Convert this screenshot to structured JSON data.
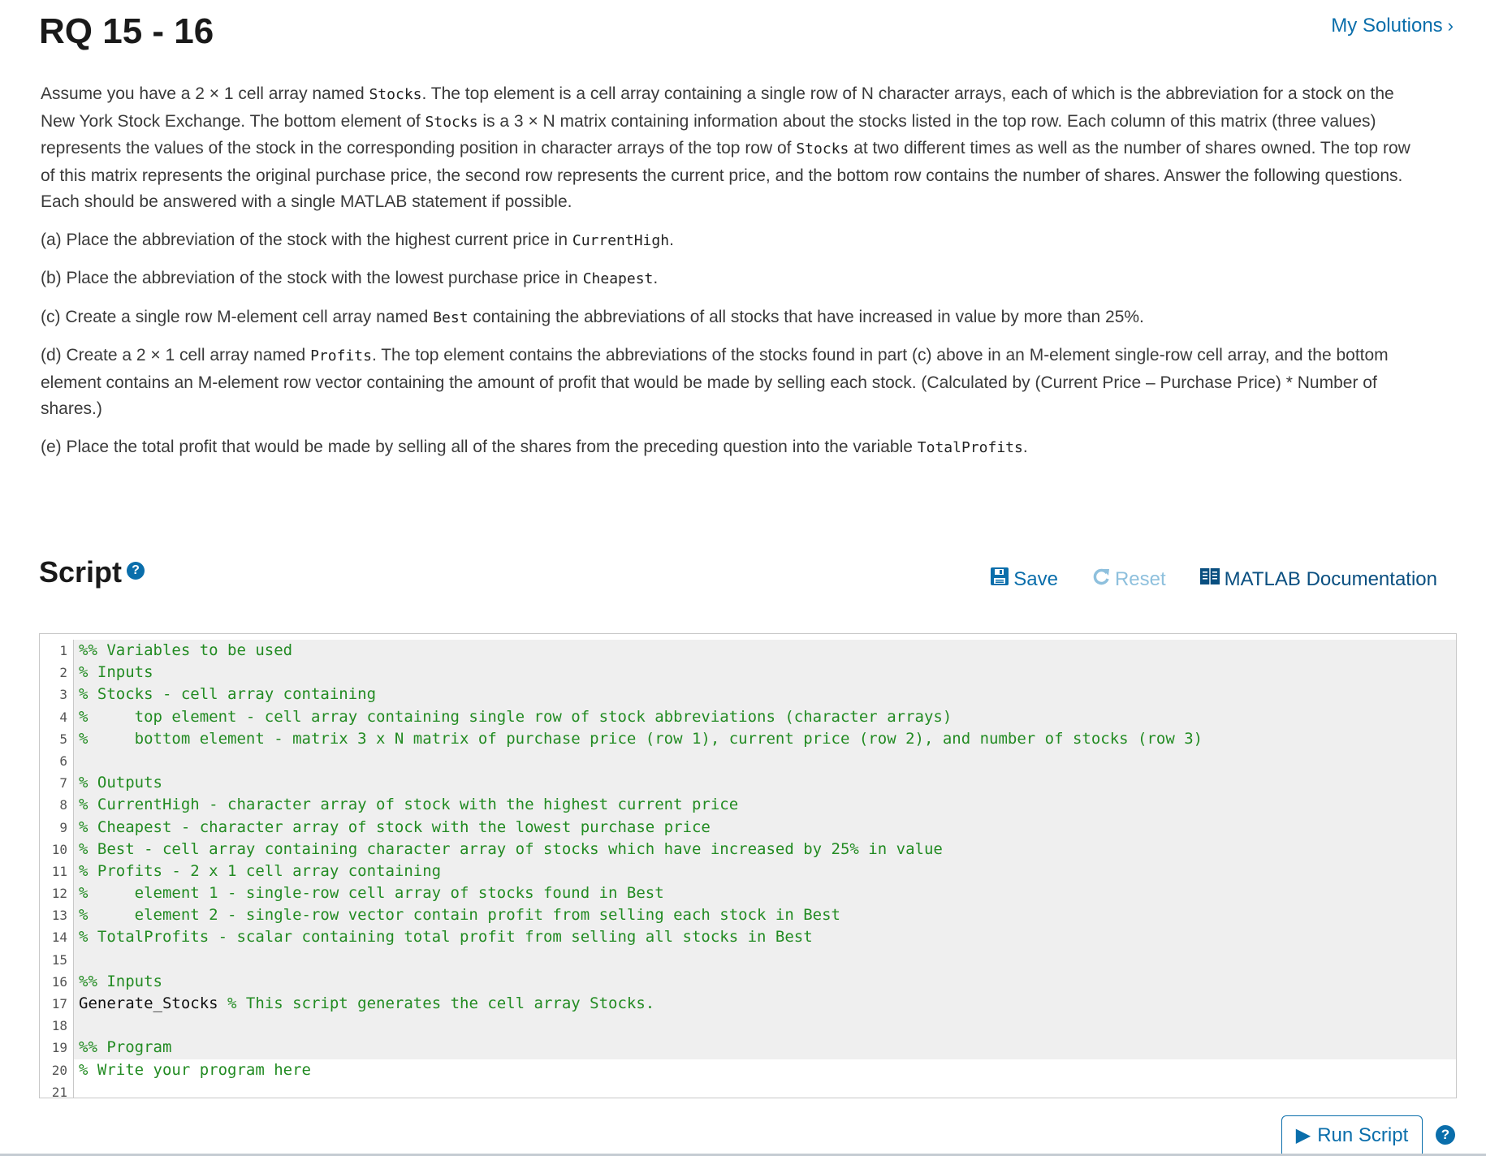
{
  "header": {
    "title": "RQ 15 - 16",
    "my_solutions_label": "My Solutions",
    "my_solutions_icon": "chevron-right-icon"
  },
  "description": {
    "intro": [
      {
        "t": "Assume you have a 2 × 1 cell array named "
      },
      {
        "c": "Stocks"
      },
      {
        "t": ". The top element is a cell array containing a single row of N character arrays, each of which is the abbreviation for a stock on the New York Stock Exchange. The bottom element of "
      },
      {
        "c": "Stocks"
      },
      {
        "t": " is a 3 × N matrix containing information about the stocks listed in the top row. Each column of this matrix (three values) represents the values of the stock in the corresponding position in character arrays of the top row of "
      },
      {
        "c": "Stocks"
      },
      {
        "t": " at two different times as well as the number of shares owned. The top row of this matrix represents the original purchase price, the second row represents the current price, and the bottom row contains the number of shares. Answer the following questions. Each should be answered with a single MATLAB statement if possible."
      }
    ],
    "parts": [
      [
        {
          "t": "(a) Place the abbreviation of the stock with the highest current price in "
        },
        {
          "c": "CurrentHigh"
        },
        {
          "t": "."
        }
      ],
      [
        {
          "t": "(b) Place the abbreviation of the stock with the lowest purchase price in "
        },
        {
          "c": "Cheapest"
        },
        {
          "t": "."
        }
      ],
      [
        {
          "t": "(c) Create a single row M-element cell array named "
        },
        {
          "c": "Best"
        },
        {
          "t": " containing the abbreviations of all stocks that have increased in value by more than 25%."
        }
      ],
      [
        {
          "t": "(d) Create a 2 × 1 cell array named "
        },
        {
          "c": "Profits"
        },
        {
          "t": ". The top element contains the abbreviations of the stocks found in part (c) above in an M-element single-row cell array, and the bottom element contains an M-element row vector containing the amount of profit that would be made by selling each stock. (Calculated by (Current Price – Purchase Price) * Number of shares.)"
        }
      ],
      [
        {
          "t": "(e) Place the total profit that would be made by selling all of the shares from the preceding question into the variable "
        },
        {
          "c": "TotalProfits"
        },
        {
          "t": "."
        }
      ]
    ]
  },
  "script": {
    "heading": "Script",
    "help_icon": "question-circle-icon",
    "toolbar": {
      "save_label": "Save",
      "save_icon": "floppy-disk-icon",
      "reset_label": "Reset",
      "reset_icon": "refresh-icon",
      "docs_label": "MATLAB Documentation",
      "docs_icon": "book-icon"
    },
    "lines": [
      {
        "n": "1",
        "ro": true,
        "segs": [
          {
            "k": "comment",
            "s": "%% Variables to be used"
          }
        ]
      },
      {
        "n": "2",
        "ro": true,
        "segs": [
          {
            "k": "comment",
            "s": "% Inputs"
          }
        ]
      },
      {
        "n": "3",
        "ro": true,
        "segs": [
          {
            "k": "comment",
            "s": "% Stocks - cell array containing"
          }
        ]
      },
      {
        "n": "4",
        "ro": true,
        "segs": [
          {
            "k": "comment",
            "s": "%     top element - cell array containing single row of stock abbreviations (character arrays)"
          }
        ]
      },
      {
        "n": "5",
        "ro": true,
        "segs": [
          {
            "k": "comment",
            "s": "%     bottom element - matrix 3 x N matrix of purchase price (row 1), current price (row 2), and number of stocks (row 3)"
          }
        ]
      },
      {
        "n": "6",
        "ro": true,
        "segs": []
      },
      {
        "n": "7",
        "ro": true,
        "segs": [
          {
            "k": "comment",
            "s": "% Outputs"
          }
        ]
      },
      {
        "n": "8",
        "ro": true,
        "segs": [
          {
            "k": "comment",
            "s": "% CurrentHigh - character array of stock with the highest current price"
          }
        ]
      },
      {
        "n": "9",
        "ro": true,
        "segs": [
          {
            "k": "comment",
            "s": "% Cheapest - character array of stock with the lowest purchase price"
          }
        ]
      },
      {
        "n": "10",
        "ro": true,
        "segs": [
          {
            "k": "comment",
            "s": "% Best - cell array containing character array of stocks which have increased by 25% in value"
          }
        ]
      },
      {
        "n": "11",
        "ro": true,
        "segs": [
          {
            "k": "comment",
            "s": "% Profits - 2 x 1 cell array containing"
          }
        ]
      },
      {
        "n": "12",
        "ro": true,
        "segs": [
          {
            "k": "comment",
            "s": "%     element 1 - single-row cell array of stocks found in Best"
          }
        ]
      },
      {
        "n": "13",
        "ro": true,
        "segs": [
          {
            "k": "comment",
            "s": "%     element 2 - single-row vector contain profit from selling each stock in Best"
          }
        ]
      },
      {
        "n": "14",
        "ro": true,
        "segs": [
          {
            "k": "comment",
            "s": "% TotalProfits - scalar containing total profit from selling all stocks in Best"
          }
        ]
      },
      {
        "n": "15",
        "ro": true,
        "segs": []
      },
      {
        "n": "16",
        "ro": true,
        "segs": [
          {
            "k": "comment",
            "s": "%% Inputs"
          }
        ]
      },
      {
        "n": "17",
        "ro": true,
        "segs": [
          {
            "k": "plain",
            "s": "Generate_Stocks "
          },
          {
            "k": "comment",
            "s": "% This script generates the cell array Stocks."
          }
        ]
      },
      {
        "n": "18",
        "ro": true,
        "segs": []
      },
      {
        "n": "19",
        "ro": true,
        "segs": [
          {
            "k": "comment",
            "s": "%% Program"
          }
        ]
      },
      {
        "n": "20",
        "ro": false,
        "segs": [
          {
            "k": "comment",
            "s": "% Write your program here"
          }
        ]
      },
      {
        "n": "21",
        "ro": false,
        "segs": []
      }
    ],
    "run_label": "Run Script",
    "run_icon": "play-icon",
    "run_help_icon": "question-circle-icon"
  },
  "colors": {
    "link": "#0a6eab",
    "comment": "#228b22",
    "readonly_bg": "#efefef"
  }
}
